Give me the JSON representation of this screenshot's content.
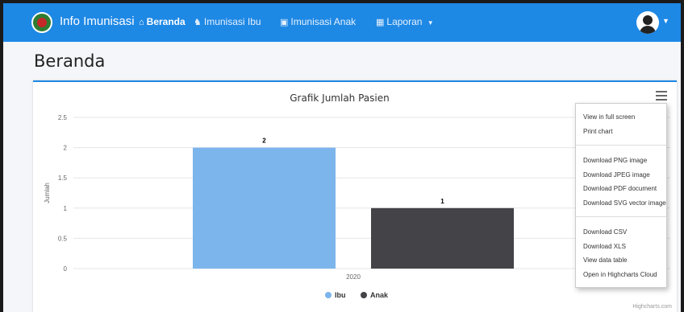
{
  "nav": {
    "brand": "Info Imunisasi",
    "items": [
      {
        "label": "Beranda",
        "icon": "home-icon"
      },
      {
        "label": "Imunisasi Ibu",
        "icon": "mother-icon"
      },
      {
        "label": "Imunisasi Anak",
        "icon": "child-icon"
      },
      {
        "label": "Laporan",
        "icon": "report-icon"
      }
    ],
    "color": "#1e88e5"
  },
  "page": {
    "title": "Beranda"
  },
  "export_menu": {
    "items": [
      "View in full screen",
      "Print chart",
      "Download PNG image",
      "Download JPEG image",
      "Download PDF document",
      "Download SVG vector image",
      "Download CSV",
      "Download XLS",
      "View data table",
      "Open in Highcharts Cloud"
    ]
  },
  "credits": "Highcharts.com",
  "chart_data": {
    "type": "bar",
    "title": "Grafik Jumlah Pasien",
    "categories": [
      "2020"
    ],
    "ylabel": "Jumlah",
    "ylim": [
      0,
      2.5
    ],
    "yticks": [
      "0",
      "0.5",
      "1",
      "1.5",
      "2",
      "2.5"
    ],
    "grid": true,
    "legend": "bottom-center",
    "series": [
      {
        "name": "Ibu",
        "values": [
          2
        ],
        "color": "#7cb5ec"
      },
      {
        "name": "Anak",
        "values": [
          1
        ],
        "color": "#434348"
      }
    ]
  }
}
